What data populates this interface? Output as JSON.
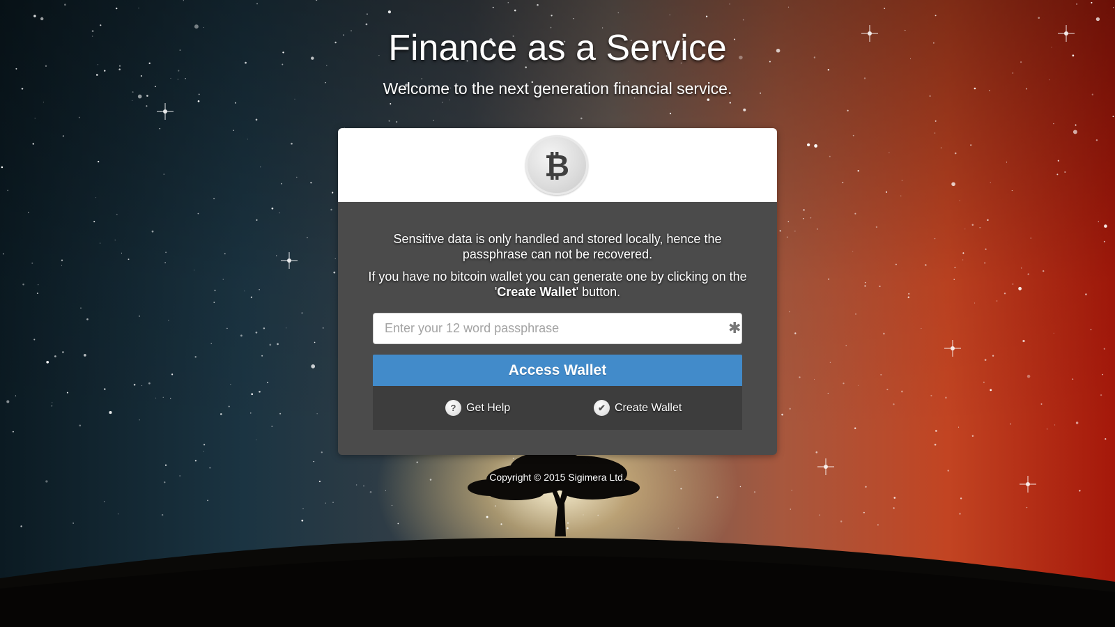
{
  "header": {
    "title": "Finance as a Service",
    "subtitle": "Welcome to the next generation financial service."
  },
  "logo": {
    "icon": "bitcoin-icon",
    "symbol": "₿"
  },
  "notice": {
    "line1": "Sensitive data is only handled and stored locally, hence the passphrase can not be recovered.",
    "line2_prefix": "If you have no bitcoin wallet you can generate one by clicking on the '",
    "line2_bold": "Create Wallet",
    "line2_suffix": "' button."
  },
  "passphrase": {
    "value": "",
    "placeholder": "Enter your 12 word passphrase",
    "required_icon": "asterisk-icon"
  },
  "actions": {
    "access_label": "Access Wallet",
    "help_label": "Get Help",
    "help_icon": "question-icon",
    "create_label": "Create Wallet",
    "create_icon": "checkmark-icon"
  },
  "footer": {
    "copyright": "Copyright © 2015  Sigimera Ltd."
  },
  "colors": {
    "accent": "#428bca",
    "card_body": "#4b4b4b",
    "card_links": "#3d3d3d",
    "card_top": "#ffffff"
  }
}
